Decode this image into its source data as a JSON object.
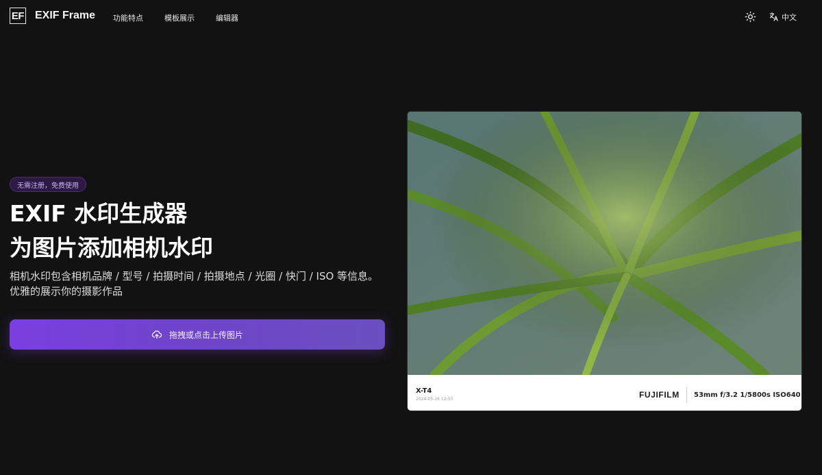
{
  "header": {
    "logo_text": "EF",
    "brand": "EXIF Frame",
    "nav": [
      "功能特点",
      "模板展示",
      "编辑器"
    ],
    "theme_icon": "sun-icon",
    "language_icon": "translate-icon",
    "language_label": "中文"
  },
  "hero": {
    "badge": "无需注册，免费使用",
    "headline_line1": "EXIF 水印生成器",
    "headline_line2": "为图片添加相机水印",
    "description": "相机水印包含相机品牌 / 型号 / 拍摄时间 / 拍摄地点 / 光圈 / 快门 / ISO 等信息。优雅的展示你的摄影作品",
    "upload_icon": "cloud-upload-icon",
    "upload_label": "拖拽或点击上传图片"
  },
  "preview": {
    "camera_model": "X-T4",
    "datetime": "2024-05-16 12:33",
    "brand_logo": "FUJIFILM",
    "exif_params": "53mm f/3.2 1/5800s ISO640"
  },
  "colors": {
    "background": "#121212",
    "accent": "#7a3fe0",
    "badge_bg": "#2c1a44",
    "badge_text": "#c9b2f0"
  }
}
